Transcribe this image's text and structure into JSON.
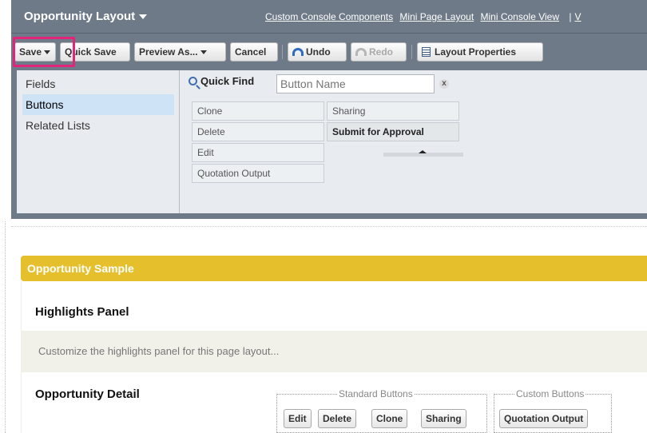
{
  "header": {
    "title": "Opportunity Layout",
    "links": [
      "Custom Console Components",
      "Mini Page Layout",
      "Mini Console View"
    ],
    "separator": "|",
    "overflow_link": "V"
  },
  "toolbar": {
    "save": "Save",
    "quick_save": "Quick Save",
    "preview_as": "Preview As...",
    "cancel": "Cancel",
    "undo": "Undo",
    "redo": "Redo",
    "layout_properties": "Layout Properties"
  },
  "palette": {
    "categories": [
      "Fields",
      "Buttons",
      "Related Lists"
    ],
    "selected_category": "Buttons",
    "quick_find_label": "Quick Find",
    "quick_find_placeholder": "Button Name",
    "clear_symbol": "x",
    "items": [
      "Clone",
      "Delete",
      "Edit",
      "Quotation Output",
      "Sharing",
      "Submit for Approval"
    ]
  },
  "layout": {
    "section_title": "Opportunity Sample",
    "highlights_title": "Highlights Panel",
    "highlights_hint": "Customize the highlights panel for this page layout...",
    "detail_title": "Opportunity Detail",
    "standard_buttons_legend": "Standard Buttons",
    "standard_buttons": [
      "Edit",
      "Delete",
      "Clone",
      "Sharing"
    ],
    "custom_buttons_legend": "Custom Buttons",
    "custom_buttons": [
      "Quotation Output"
    ]
  },
  "colors": {
    "header_bg": "#6f7a89",
    "highlight_border": "#e0257a",
    "section_bar": "#e6bf2c",
    "selected_category": "#cfe3f6"
  }
}
